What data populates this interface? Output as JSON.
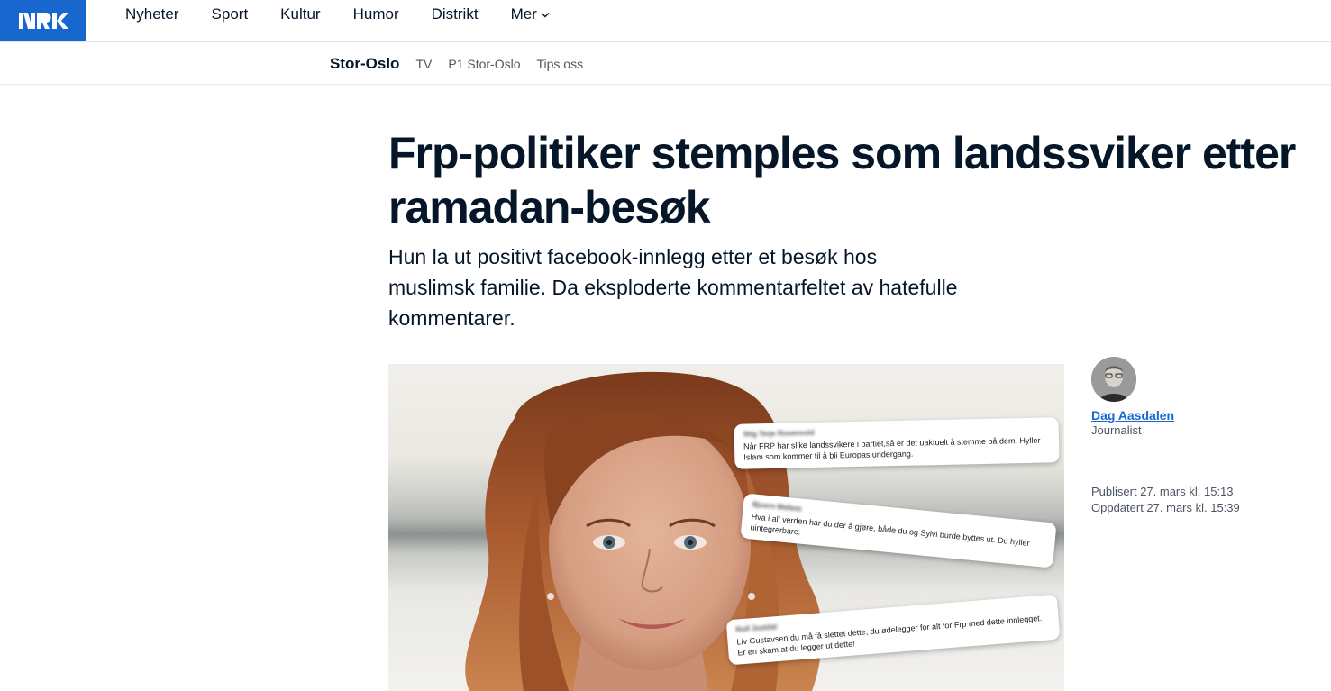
{
  "header": {
    "logo_text": "NRK",
    "brand_color": "#1767ce",
    "nav": [
      "Nyheter",
      "Sport",
      "Kultur",
      "Humor",
      "Distrikt",
      "Mer"
    ]
  },
  "subnav": {
    "region": "Stor-Oslo",
    "items": [
      "TV",
      "P1 Stor-Oslo",
      "Tips oss"
    ]
  },
  "article": {
    "title": "Frp-politiker stemples som landssviker etter ramadan-besøk",
    "lead": "Hun la ut positivt facebook-innlegg etter et besøk hos muslimsk familie. Da eksploderte kommentarfeltet av hatefulle kommentarer.",
    "image_comments": [
      {
        "author": "Stig Terje Rosenvold",
        "text": "Når FRP har slike landssvikere i partiet,så er det uaktuelt å stemme på dem. Hyller Islam som kommer til å bli Europas undergang."
      },
      {
        "author": "Bjoern Mellem",
        "text": "Hva i all verden har du der å gjøre, både du og Sylvi burde byttes ut. Du hyller uintegrerbare."
      },
      {
        "author": "Rolf Jostdal",
        "text": "Liv Gustavsen du må få slettet dette, du ødelegger for alt for Frp med dette innlegget. Er en skam at du legger ut dette!"
      }
    ]
  },
  "byline": {
    "author": "Dag Aasdalen",
    "role": "Journalist",
    "published": "Publisert 27. mars kl. 15:13",
    "updated": "Oppdatert 27. mars kl. 15:39"
  }
}
